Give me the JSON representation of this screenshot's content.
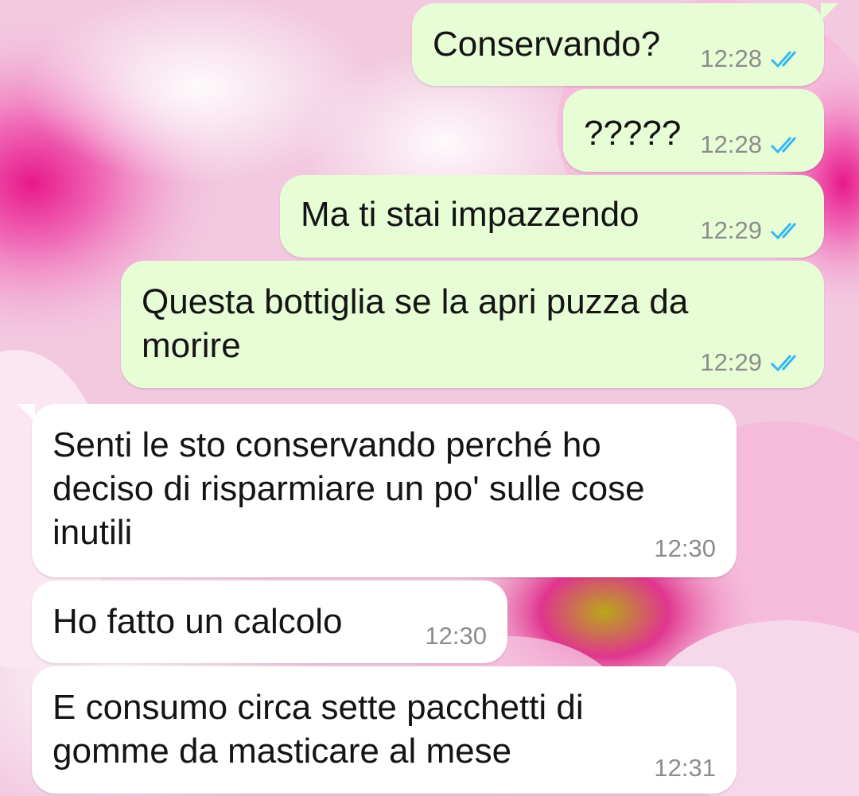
{
  "theme": {
    "outgoing_bubble": "#e7fdd6",
    "incoming_bubble": "#ffffff",
    "read_ticks": "#34b7f1",
    "wallpaper": "pink-flowers"
  },
  "messages": [
    {
      "direction": "outgoing",
      "text": "Conservando?",
      "time": "12:28",
      "status": "read"
    },
    {
      "direction": "outgoing",
      "text": "?????",
      "time": "12:28",
      "status": "read"
    },
    {
      "direction": "outgoing",
      "text": "Ma ti stai impazzendo",
      "time": "12:29",
      "status": "read"
    },
    {
      "direction": "outgoing",
      "text": "Questa bottiglia se la apri puzza da\nmorire",
      "time": "12:29",
      "status": "read"
    },
    {
      "direction": "incoming",
      "text": "Senti le sto conservando perché ho\ndeciso di risparmiare un po' sulle cose\ninutili",
      "time": "12:30"
    },
    {
      "direction": "incoming",
      "text": "Ho fatto un calcolo",
      "time": "12:30"
    },
    {
      "direction": "incoming",
      "text": "E consumo circa sette pacchetti di\ngomme da masticare al mese",
      "time": "12:31"
    }
  ]
}
